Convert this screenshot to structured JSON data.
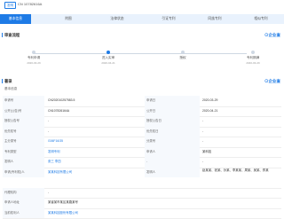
{
  "header": {
    "chip": "发明",
    "patent_no": "CN 10782616A"
  },
  "tabs": [
    {
      "label": "基本信息",
      "active": true
    },
    {
      "label": "附图",
      "active": false
    },
    {
      "label": "法律状态",
      "active": false
    },
    {
      "label": "引证专利",
      "active": false
    },
    {
      "label": "同族专利",
      "active": false
    },
    {
      "label": "相似专利",
      "active": false
    }
  ],
  "status_section": {
    "title": "审查流程",
    "watch_label": "⊙企业查"
  },
  "timeline": [
    {
      "label": "专利申请",
      "date": "2020-03-29",
      "done": false
    },
    {
      "label": "进入实审",
      "date": "2020-04-21",
      "done": true
    },
    {
      "label": "授权",
      "date": "",
      "done": false
    },
    {
      "label": "专利期满",
      "date": "2040-03-29",
      "done": false
    }
  ],
  "info_section": {
    "title": "著录",
    "subtitle": "基本信息",
    "watch_label": "⊙企业查"
  },
  "rows": [
    {
      "l1": "申请号",
      "v1": "CN202010257583.5",
      "l2": "申请日",
      "v2": "2020-03-29"
    },
    {
      "l1": "公开(公告)号",
      "v1": "CN107826164A",
      "l2": "公开日",
      "v2": "2020-04-21"
    },
    {
      "l1": "授权公告号",
      "v1": "-",
      "l2": "授权公告日",
      "v2": "-"
    },
    {
      "l1": "优先权号",
      "v1": "-",
      "l2": "优先权日",
      "v2": "-"
    },
    {
      "l1": "主分类号",
      "v1": "G06F16/35",
      "l2": "分类号",
      "v2": "-"
    },
    {
      "l1": "专利类型",
      "v1": "发明专利",
      "l2": "申请人",
      "v2": "某科技"
    },
    {
      "l1": "发明人",
      "v1": "张三 李四",
      "l2": "-",
      "v2": "-"
    },
    {
      "l1": "申请(专利权)人",
      "v1": "某某科技有限公司",
      "l2": "发明人",
      "v2": "赵某某、钱某、孙某、李某某、周某、吴某、郑某"
    },
    {
      "l1": "代理机构",
      "v1": "-",
      "l2": "",
      "v2": ""
    },
    {
      "l1": "申请人地址",
      "v1": "某省某市某区某路某号",
      "l2": "",
      "v2": ""
    },
    {
      "l1": "当前权利人",
      "v1": "某某科技股份有限公司",
      "l2": "",
      "v2": ""
    }
  ]
}
